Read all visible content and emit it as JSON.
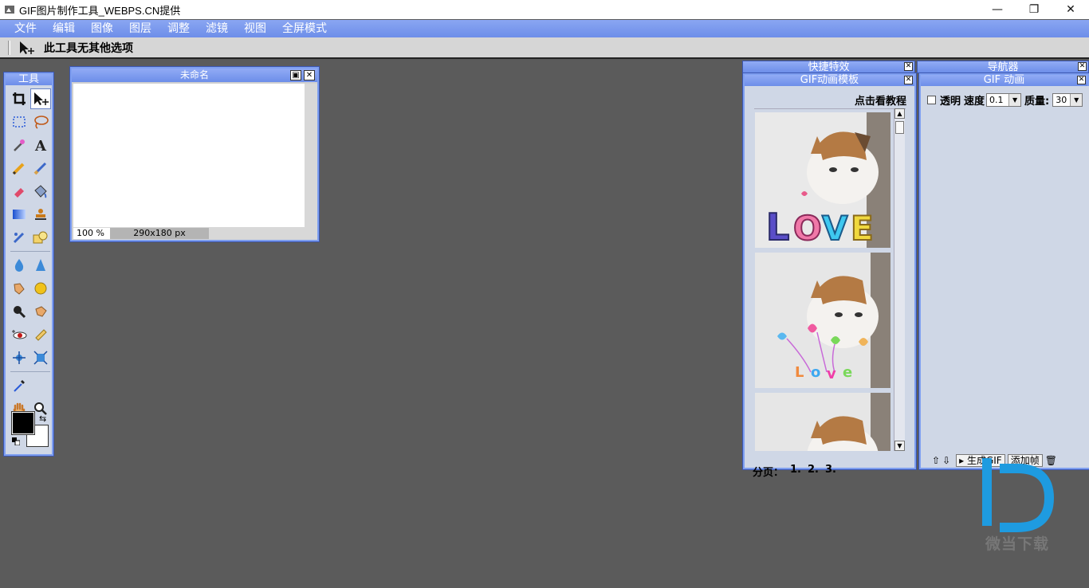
{
  "window": {
    "title": "GIF图片制作工具_WEBPS.CN提供",
    "minimize": "—",
    "restore": "❐",
    "close": "✕"
  },
  "menu": [
    "文件",
    "编辑",
    "图像",
    "图层",
    "调整",
    "滤镜",
    "视图",
    "全屏模式"
  ],
  "options_bar": {
    "text": "此工具无其他选项"
  },
  "tools_panel": {
    "title": "工具",
    "foreground_color": "#000000",
    "background_color": "#ffffff"
  },
  "document": {
    "title": "未命名",
    "zoom": "100",
    "zoom_unit": "%",
    "dimensions": "290x180 px"
  },
  "panels": {
    "shortcuts_title": "快捷特效",
    "navigator_title": "导航器",
    "templates": {
      "title": "GIF动画模板",
      "tutorial_link": "点击看教程",
      "pager_label": "分页：",
      "pages": [
        "1.",
        "2.",
        "3."
      ]
    },
    "animation": {
      "title": "GIF 动画",
      "transparent_label": "透明",
      "speed_label": "速度",
      "speed_value": "0.1",
      "quality_label": "质量:",
      "quality_value": "30",
      "generate_label": "生成GIF",
      "add_frame_label": "添加帧"
    }
  },
  "watermark": {
    "text": "微当下载"
  }
}
